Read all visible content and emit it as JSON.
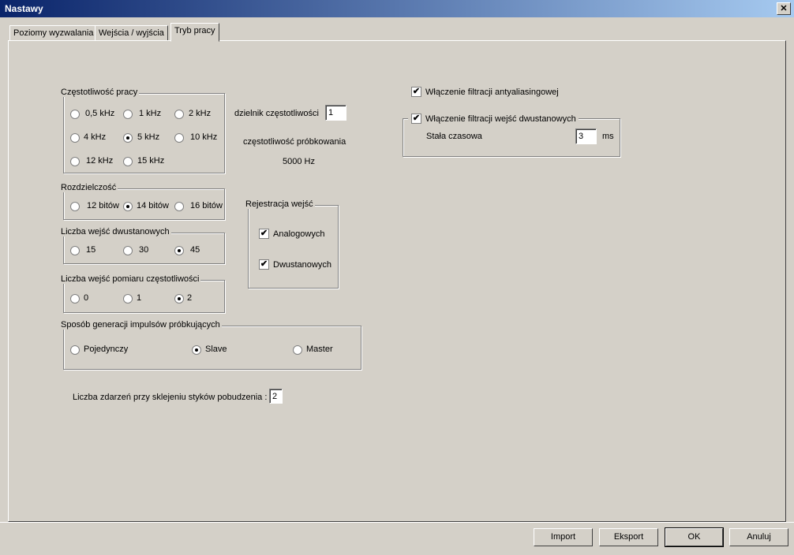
{
  "window": {
    "title": "Nastawy",
    "close_glyph": "✕"
  },
  "tabs": [
    {
      "label": "Poziomy wyzwalania"
    },
    {
      "label": "Wejścia / wyjścia"
    },
    {
      "label": "Tryb pracy"
    }
  ],
  "frequency": {
    "title": "Częstotliwość pracy",
    "options": [
      "0,5 kHz",
      "1 kHz",
      "2 kHz",
      "4 kHz",
      "5 kHz",
      "10 kHz",
      "12 kHz",
      "15 kHz"
    ],
    "selected": "5 kHz",
    "divider_label": "dzielnik częstotliwości",
    "divider_value": "1",
    "sampling_label": "częstotliwość próbkowania",
    "sampling_value": "5000  Hz"
  },
  "resolution": {
    "title": "Rozdzielczość",
    "options": [
      "12 bitów",
      "14 bitów",
      "16 bitów"
    ],
    "selected": "14 bitów"
  },
  "binary_inputs": {
    "title": "Liczba wejść dwustanowych",
    "options": [
      "15",
      "30",
      "45"
    ],
    "selected": "45"
  },
  "freq_inputs": {
    "title": "Liczba wejść pomiaru częstotliwości",
    "options": [
      "0",
      "1",
      "2"
    ],
    "selected": "2"
  },
  "pulse_generation": {
    "title": "Sposób generacji impulsów próbkujących",
    "options": [
      "Pojedynczy",
      "Slave",
      "Master"
    ],
    "selected": "Slave"
  },
  "registration": {
    "title": "Rejestracja wejść",
    "analog_label": "Analogowych",
    "analog_checked": true,
    "binary_label": "Dwustanowych",
    "binary_checked": true
  },
  "events": {
    "label": "Liczba zdarzeń przy sklejeniu styków pobudzenia :",
    "value": "2"
  },
  "antialias": {
    "label": "Włączenie filtracji antyaliasingowej",
    "checked": true
  },
  "binary_filter": {
    "label": "Włączenie filtracji wejść dwustanowych",
    "checked": true,
    "time_label": "Stała czasowa",
    "time_value": "3",
    "unit": "ms"
  },
  "buttons": {
    "import": "Import",
    "export": "Eksport",
    "ok": "OK",
    "cancel": "Anuluj"
  }
}
